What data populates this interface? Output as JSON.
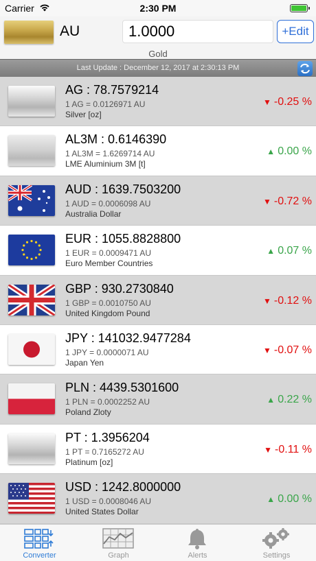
{
  "status_bar": {
    "carrier": "Carrier",
    "time": "2:30 PM",
    "battery_level": 1.0
  },
  "header": {
    "base_code": "AU",
    "amount": "1.0000",
    "edit_label": "+Edit",
    "base_name": "Gold"
  },
  "update_bar": {
    "text": "Last Update : December 12, 2017 at 2:30:13 PM"
  },
  "rates": [
    {
      "flag": "silver",
      "title": "AG : 78.7579214",
      "inverse": "1 AG = 0.0126971 AU",
      "name": "Silver [oz]",
      "change": "-0.25 %",
      "direction": "down"
    },
    {
      "flag": "aluminium",
      "title": "AL3M : 0.6146390",
      "inverse": "1 AL3M = 1.6269714 AU",
      "name": "LME Aluminium 3M [t]",
      "change": "0.00 %",
      "direction": "up"
    },
    {
      "flag": "australia",
      "title": "AUD : 1639.7503200",
      "inverse": "1 AUD = 0.0006098 AU",
      "name": "Australia Dollar",
      "change": "-0.72 %",
      "direction": "down"
    },
    {
      "flag": "eu",
      "title": "EUR : 1055.8828800",
      "inverse": "1 EUR = 0.0009471 AU",
      "name": "Euro Member Countries",
      "change": "0.07 %",
      "direction": "up"
    },
    {
      "flag": "uk",
      "title": "GBP : 930.2730840",
      "inverse": "1 GBP = 0.0010750 AU",
      "name": "United Kingdom Pound",
      "change": "-0.12 %",
      "direction": "down"
    },
    {
      "flag": "japan",
      "title": "JPY : 141032.9477284",
      "inverse": "1 JPY = 0.0000071 AU",
      "name": "Japan Yen",
      "change": "-0.07 %",
      "direction": "down"
    },
    {
      "flag": "poland",
      "title": "PLN : 4439.5301600",
      "inverse": "1 PLN = 0.0002252 AU",
      "name": "Poland Zloty",
      "change": "0.22 %",
      "direction": "up"
    },
    {
      "flag": "platinum",
      "title": "PT : 1.3956204",
      "inverse": "1 PT = 0.7165272 AU",
      "name": "Platinum [oz]",
      "change": "-0.11 %",
      "direction": "down"
    },
    {
      "flag": "usa",
      "title": "USD : 1242.8000000",
      "inverse": "1 USD = 0.0008046 AU",
      "name": "United States Dollar",
      "change": "0.00 %",
      "direction": "up"
    }
  ],
  "tabs": [
    {
      "label": "Converter",
      "icon": "converter-icon",
      "active": true
    },
    {
      "label": "Graph",
      "icon": "graph-icon",
      "active": false
    },
    {
      "label": "Alerts",
      "icon": "bell-icon",
      "active": false
    },
    {
      "label": "Settings",
      "icon": "gears-icon",
      "active": false
    }
  ],
  "colors": {
    "accent": "#2f7cd6",
    "down": "#e10f0f",
    "up": "#3aa54a",
    "row_alt": "#d7d7d7"
  }
}
